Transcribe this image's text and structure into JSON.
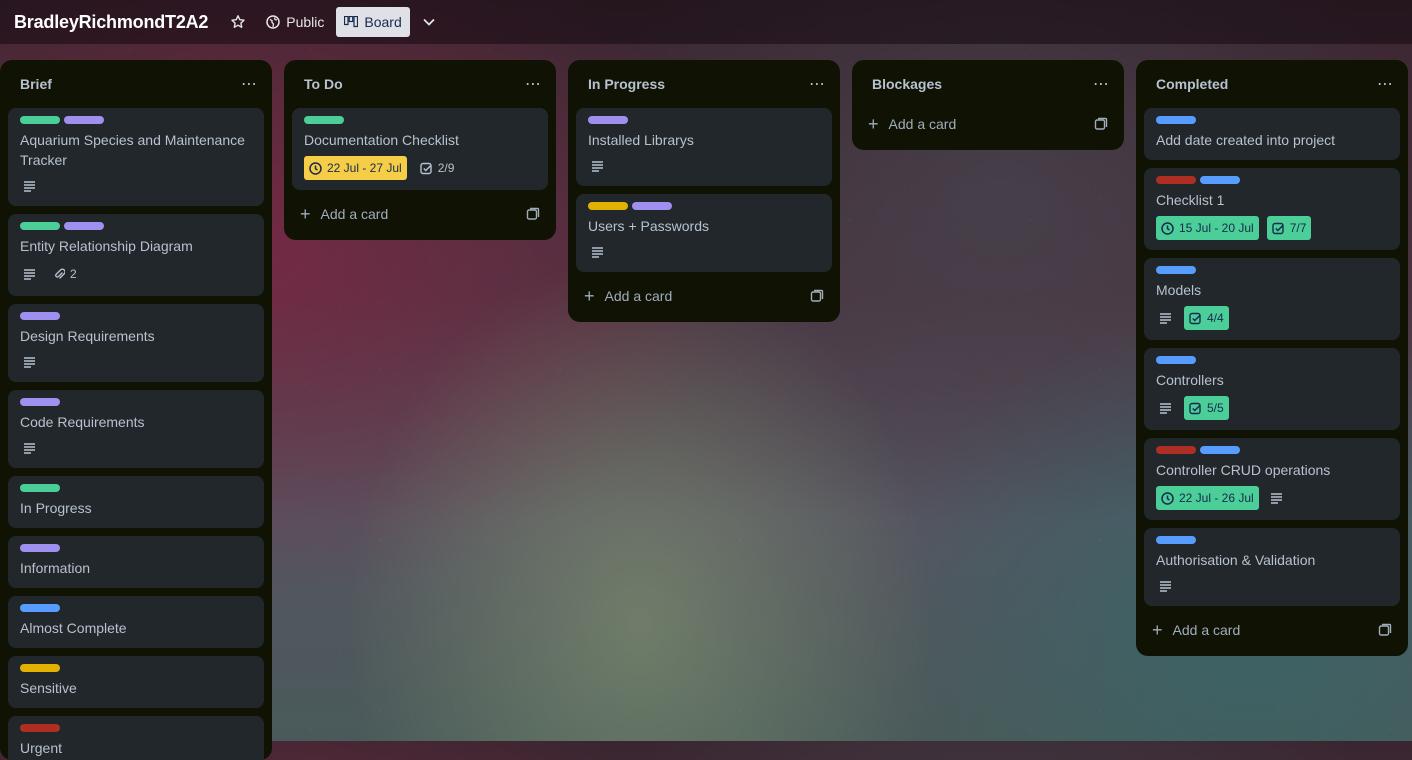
{
  "header": {
    "board_title": "BradleyRichmondT2A2",
    "visibility": "Public",
    "view": "Board"
  },
  "colors": {
    "green": "#4bce97",
    "purple": "#9f8fef",
    "blue": "#579dff",
    "yellow": "#e2b203",
    "red": "#ae2e24"
  },
  "add_card_label": "Add a card",
  "lists": [
    {
      "title": "Brief",
      "cards": [
        {
          "title": "Aquarium Species and Maintenance Tracker",
          "labels": [
            "green",
            "purple"
          ],
          "description": true
        },
        {
          "title": "Entity Relationship Diagram",
          "labels": [
            "green",
            "purple"
          ],
          "description": true,
          "attachments": "2"
        },
        {
          "title": "Design Requirements",
          "labels": [
            "purple"
          ],
          "description": true
        },
        {
          "title": "Code Requirements",
          "labels": [
            "purple"
          ],
          "description": true
        },
        {
          "title": "In Progress",
          "labels": [
            "green"
          ]
        },
        {
          "title": "Information",
          "labels": [
            "purple"
          ]
        },
        {
          "title": "Almost Complete",
          "labels": [
            "blue"
          ]
        },
        {
          "title": "Sensitive",
          "labels": [
            "yellow"
          ]
        },
        {
          "title": "Urgent",
          "labels": [
            "red"
          ]
        }
      ]
    },
    {
      "title": "To Do",
      "cards": [
        {
          "title": "Documentation Checklist",
          "labels": [
            "green"
          ],
          "date": "22 Jul - 27 Jul",
          "date_style": "yellow",
          "checklist": "2/9",
          "checklist_style": "plain"
        }
      ]
    },
    {
      "title": "In Progress",
      "cards": [
        {
          "title": "Installed Librarys",
          "labels": [
            "purple"
          ],
          "description": true
        },
        {
          "title": "Users + Passwords",
          "labels": [
            "yellow",
            "purple"
          ],
          "description": true
        }
      ]
    },
    {
      "title": "Blockages",
      "cards": []
    },
    {
      "title": "Completed",
      "cards": [
        {
          "title": "Add date created into project",
          "labels": [
            "blue"
          ]
        },
        {
          "title": "Checklist 1",
          "labels": [
            "red",
            "blue"
          ],
          "date": "15 Jul - 20 Jul",
          "date_style": "green",
          "checklist": "7/7",
          "checklist_style": "green"
        },
        {
          "title": "Models",
          "labels": [
            "blue"
          ],
          "description": true,
          "checklist": "4/4",
          "checklist_style": "green"
        },
        {
          "title": "Controllers",
          "labels": [
            "blue"
          ],
          "description": true,
          "checklist": "5/5",
          "checklist_style": "green"
        },
        {
          "title": "Controller CRUD operations",
          "labels": [
            "red",
            "blue"
          ],
          "date": "22 Jul - 26 Jul",
          "date_style": "green",
          "description_after": true
        },
        {
          "title": "Authorisation & Validation",
          "labels": [
            "blue"
          ],
          "description": true
        }
      ]
    }
  ]
}
